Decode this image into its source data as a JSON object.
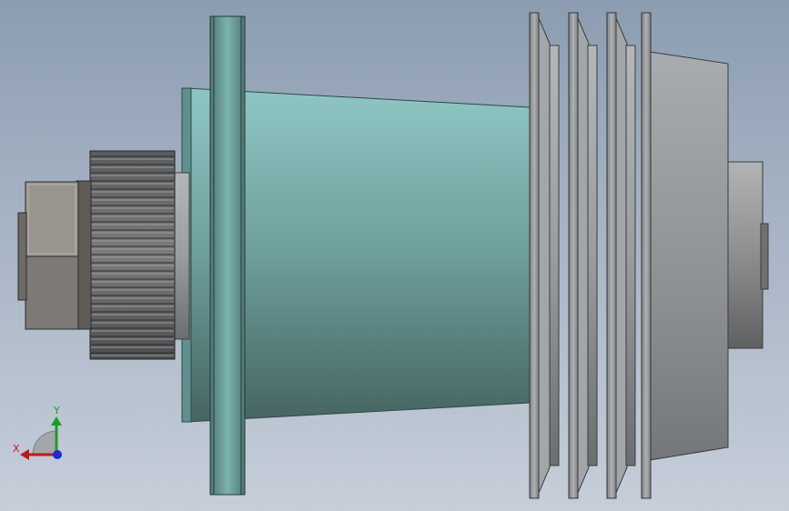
{
  "viewport": {
    "background_top": "#8c9db1",
    "background_bottom": "#c6ced9"
  },
  "model": {
    "parts": [
      "hex-nut",
      "timing-pulley",
      "flange",
      "tapered-housing",
      "v-belt-pulley",
      "shaft-end"
    ],
    "colors": {
      "housing": "#6aa3a0",
      "flange": "#6fa9a6",
      "steel": "#9a9d9f",
      "dark_steel": "#4a4c4e",
      "nut": "#8a8680"
    }
  },
  "triad": {
    "x_label": "X",
    "y_label": "Y",
    "x_color": "#c0191c",
    "y_color": "#1f9a2a",
    "z_color": "#1a2bd0"
  }
}
